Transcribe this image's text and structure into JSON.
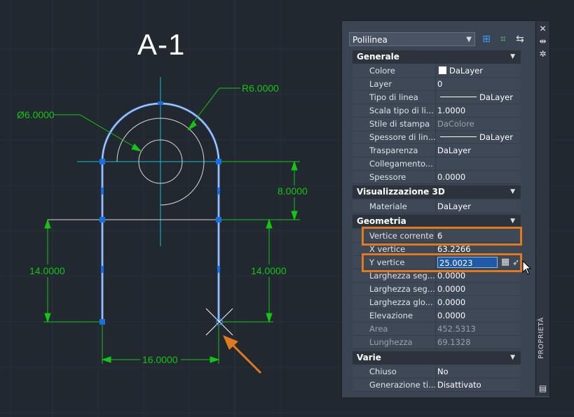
{
  "drawing": {
    "title": "A-1",
    "dims": {
      "radius": "R6.0000",
      "diameter": "Ø6.0000",
      "vertical_right_top": "8.0000",
      "vertical_left": "14.0000",
      "vertical_right": "14.0000",
      "horizontal_bottom": "16.0000"
    },
    "colors": {
      "background": "#212830",
      "polyline": "#5a8fe0",
      "dimension": "#16c416",
      "centerline": "#1fb8d8",
      "geometry": "#d8d8d8",
      "grips": "#1a6fe0",
      "callout": "#e07a1f"
    }
  },
  "palette": {
    "label": "PROPRIETÀ",
    "object_type": "Polilinea",
    "toolbar_icons": [
      "add-selection-icon",
      "quick-select-icon",
      "toggle-pickadd-icon"
    ],
    "control_icons": [
      "close-icon",
      "autohide-icon",
      "properties-menu-icon"
    ],
    "sections": {
      "generale": {
        "title": "Generale",
        "rows": [
          {
            "label": "Colore",
            "value": "DaLayer"
          },
          {
            "label": "Layer",
            "value": "0"
          },
          {
            "label": "Tipo di linea",
            "value": "DaLayer"
          },
          {
            "label": "Scala tipo di li...",
            "value": "1.0000"
          },
          {
            "label": "Stile di stampa",
            "value": "DaColore"
          },
          {
            "label": "Spessore di lin...",
            "value": "DaLayer"
          },
          {
            "label": "Trasparenza",
            "value": "DaLayer"
          },
          {
            "label": "Collegamento...",
            "value": ""
          },
          {
            "label": "Spessore",
            "value": "0.0000"
          }
        ]
      },
      "vis3d": {
        "title": "Visualizzazione 3D",
        "rows": [
          {
            "label": "Materiale",
            "value": "DaLayer"
          }
        ]
      },
      "geometria": {
        "title": "Geometria",
        "rows": [
          {
            "label": "Vertice corrente",
            "value": "6"
          },
          {
            "label": "X vertice",
            "value": "63.2266"
          },
          {
            "label": "Y vertice",
            "value": "25.0023"
          },
          {
            "label": "Larghezza  seg...",
            "value": "0.0000"
          },
          {
            "label": "Larghezza  seg...",
            "value": "0.0000"
          },
          {
            "label": "Larghezza  glo...",
            "value": "0.0000"
          },
          {
            "label": "Elevazione",
            "value": "0.0000"
          },
          {
            "label": "Area",
            "value": "452.5313"
          },
          {
            "label": "Lunghezza",
            "value": "69.1328"
          }
        ]
      },
      "varie": {
        "title": "Varie",
        "rows": [
          {
            "label": "Chiuso",
            "value": "No"
          },
          {
            "label": "Generazione  ti...",
            "value": "Disattivato"
          }
        ]
      }
    }
  }
}
